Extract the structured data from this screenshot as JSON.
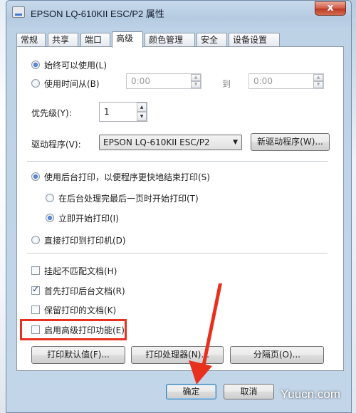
{
  "window": {
    "title": "EPSON LQ-610KII ESC/P2 属性",
    "close_label": "x"
  },
  "tabs": [
    {
      "label": "常规",
      "active": false
    },
    {
      "label": "共享",
      "active": false
    },
    {
      "label": "端口",
      "active": false
    },
    {
      "label": "高级",
      "active": true
    },
    {
      "label": "颜色管理",
      "active": false
    },
    {
      "label": "安全",
      "active": false
    },
    {
      "label": "设备设置",
      "active": false
    }
  ],
  "availability": {
    "always_label": "始终可以使用(L)",
    "always_selected": true,
    "from_label": "使用时间从(B)",
    "from_selected": false,
    "from_time": "0:00",
    "to_label": "到",
    "to_time": "0:00"
  },
  "priority": {
    "label": "优先级(Y):",
    "value": "1"
  },
  "driver": {
    "label": "驱动程序(V):",
    "selected": "EPSON LQ-610KII ESC/P2",
    "new_driver_button": "新驱动程序(W)..."
  },
  "spool": {
    "spool_label": "使用后台打印，以便程序更快地结束打印(S)",
    "spool_selected": true,
    "after_last_page_label": "在后台处理完最后一页时开始打印(T)",
    "after_last_page_selected": false,
    "immediately_label": "立即开始打印(I)",
    "immediately_selected": true,
    "direct_label": "直接打印到打印机(D)",
    "direct_selected": false
  },
  "options": [
    {
      "label": "挂起不匹配文档(H)",
      "checked": false
    },
    {
      "label": "首先打印后台文档(R)",
      "checked": true
    },
    {
      "label": "保留打印的文档(K)",
      "checked": false
    },
    {
      "label": "启用高级打印功能(E)",
      "checked": false
    }
  ],
  "bottom_buttons": {
    "defaults": "打印默认值(F)...",
    "processor": "打印处理器(N)...",
    "separator": "分隔页(O)..."
  },
  "dialog_buttons": {
    "ok": "确定",
    "cancel": "取消"
  },
  "watermark": "Yuucn.com",
  "colors": {
    "annotation_red": "#e8301f",
    "selection_blue": "#1f57b6"
  }
}
